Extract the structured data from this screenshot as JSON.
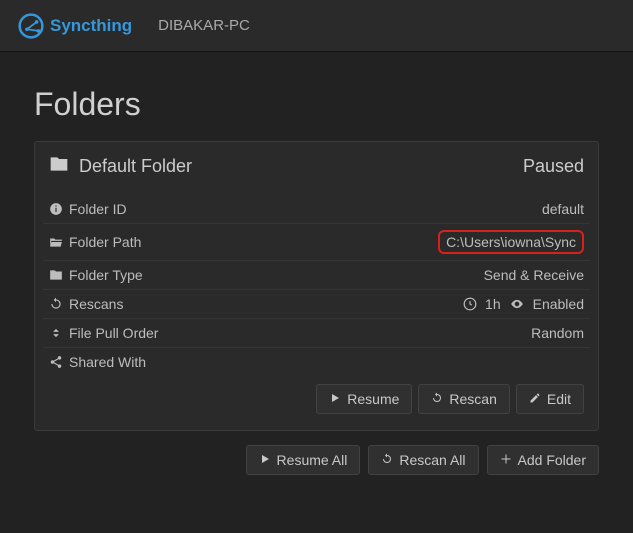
{
  "brand": {
    "name": "Syncthing"
  },
  "device_name": "DIBAKAR-PC",
  "page_title": "Folders",
  "folder": {
    "title": "Default Folder",
    "status": "Paused",
    "rows": {
      "id_label": "Folder ID",
      "id_value": "default",
      "path_label": "Folder Path",
      "path_value": "C:\\Users\\iowna\\Sync",
      "type_label": "Folder Type",
      "type_value": "Send & Receive",
      "rescans_label": "Rescans",
      "rescans_interval": "1h",
      "rescans_watch": "Enabled",
      "pull_label": "File Pull Order",
      "pull_value": "Random",
      "shared_label": "Shared With"
    },
    "actions": {
      "resume": "Resume",
      "rescan": "Rescan",
      "edit": "Edit"
    }
  },
  "global_actions": {
    "resume_all": "Resume All",
    "rescan_all": "Rescan All",
    "add_folder": "Add Folder"
  }
}
